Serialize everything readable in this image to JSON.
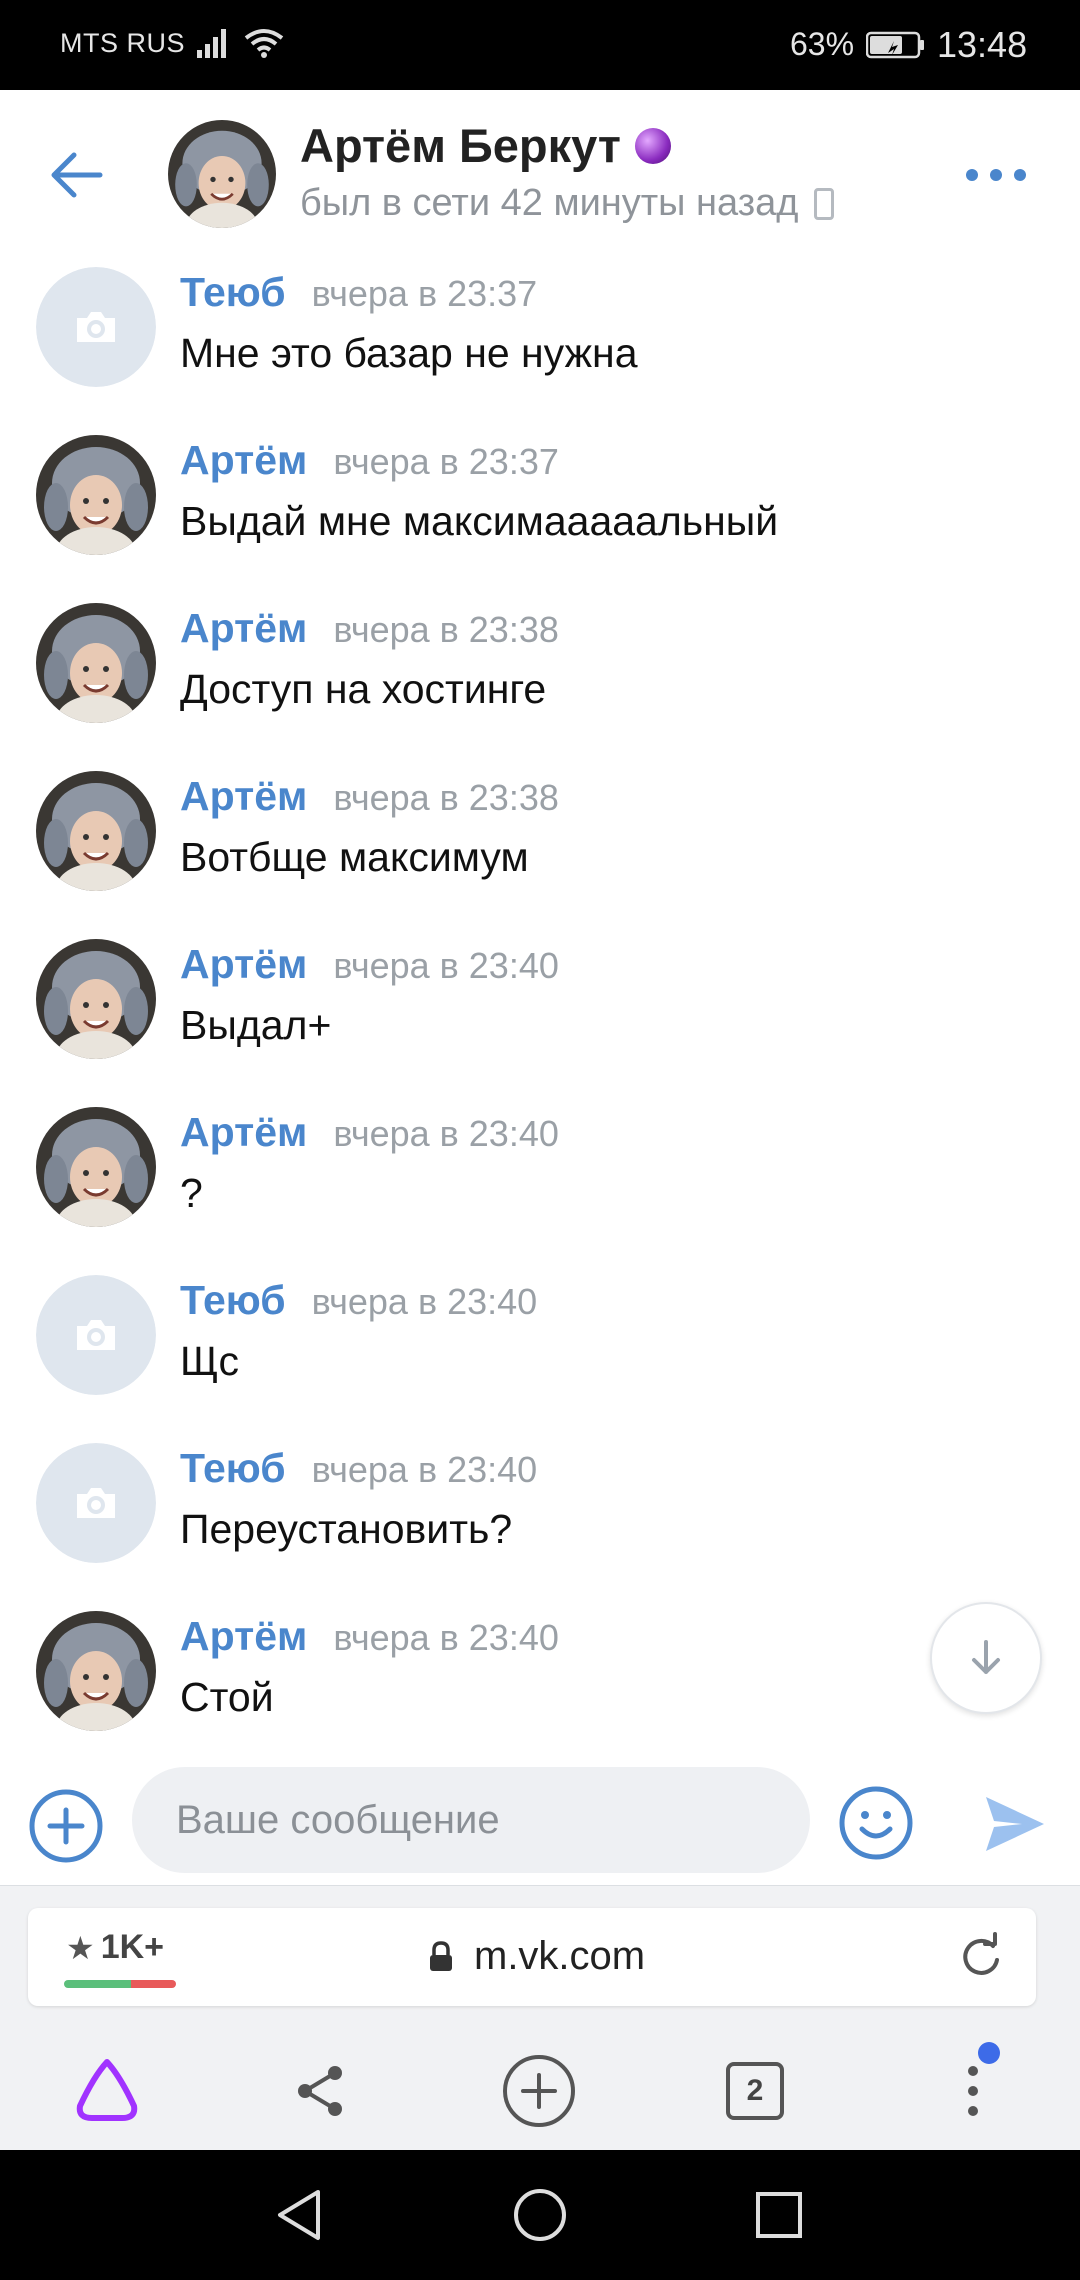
{
  "status_bar": {
    "carrier": "MTS RUS",
    "battery_percent": "63%",
    "time": "13:48"
  },
  "header": {
    "name": "Артём Беркут",
    "status": "был в сети 42 минуты назад"
  },
  "messages": [
    {
      "author": "Теюб",
      "time": "вчера в 23:37",
      "text": "Мне это базар не нужна",
      "avatar": "camera-placeholder"
    },
    {
      "author": "Артём",
      "time": "вчера в 23:37",
      "text": "Выдай мне максимааааальный",
      "avatar": "photo"
    },
    {
      "author": "Артём",
      "time": "вчера в 23:38",
      "text": "Доступ на хостинге",
      "avatar": "photo"
    },
    {
      "author": "Артём",
      "time": "вчера в 23:38",
      "text": "Вотбще максимум",
      "avatar": "photo"
    },
    {
      "author": "Артём",
      "time": "вчера в 23:40",
      "text": "Выдал+",
      "avatar": "photo"
    },
    {
      "author": "Артём",
      "time": "вчера в 23:40",
      "text": "?",
      "avatar": "photo"
    },
    {
      "author": "Теюб",
      "time": "вчера в 23:40",
      "text": "Щс",
      "avatar": "camera-placeholder"
    },
    {
      "author": "Теюб",
      "time": "вчера в 23:40",
      "text": "Переустановить?",
      "avatar": "camera-placeholder"
    },
    {
      "author": "Артём",
      "time": "вчера в 23:40",
      "text": "Стой",
      "avatar": "photo"
    }
  ],
  "composer": {
    "placeholder": "Ваше сообщение"
  },
  "browser": {
    "rating": "1K+",
    "url": "m.vk.com",
    "tabs_count": "2"
  },
  "colors": {
    "accent": "#4a86cc",
    "send": "#9cc1ef",
    "alice": "#a133ff"
  }
}
